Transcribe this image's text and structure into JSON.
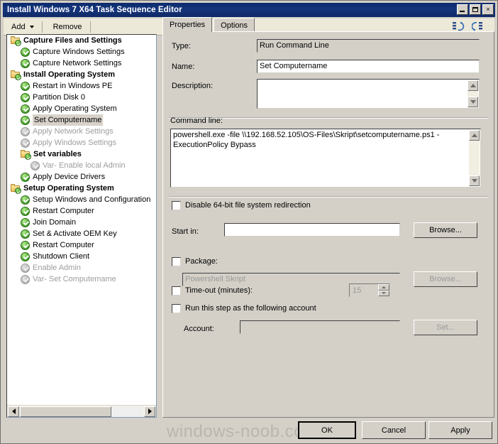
{
  "window": {
    "title": "Install Windows 7 X64 Task Sequence Editor",
    "minimize_label": "Minimize",
    "maximize_label": "Maximize",
    "close_label": "×"
  },
  "toolbar": {
    "add_label": "Add",
    "remove_label": "Remove",
    "move_up_icon": "move-up-icon",
    "move_down_icon": "move-down-icon"
  },
  "tree": {
    "items": [
      {
        "label": "Capture Files and Settings",
        "indent": 0,
        "icon": "folder",
        "style": "group"
      },
      {
        "label": "Capture Windows Settings",
        "indent": 1,
        "icon": "check",
        "style": "normal"
      },
      {
        "label": "Capture Network Settings",
        "indent": 1,
        "icon": "check",
        "style": "normal"
      },
      {
        "label": "Install Operating System",
        "indent": 0,
        "icon": "folder",
        "style": "group"
      },
      {
        "label": "Restart in Windows PE",
        "indent": 1,
        "icon": "check",
        "style": "normal"
      },
      {
        "label": "Partition Disk 0",
        "indent": 1,
        "icon": "check",
        "style": "normal"
      },
      {
        "label": "Apply Operating System",
        "indent": 1,
        "icon": "check",
        "style": "normal"
      },
      {
        "label": "Set Computername",
        "indent": 1,
        "icon": "check",
        "style": "selected"
      },
      {
        "label": "Apply Network Settings",
        "indent": 1,
        "icon": "check-gray",
        "style": "disabled"
      },
      {
        "label": "Apply Windows Settings",
        "indent": 1,
        "icon": "check-gray",
        "style": "disabled"
      },
      {
        "label": "Set variables",
        "indent": 1,
        "icon": "folder",
        "style": "group"
      },
      {
        "label": "Var- Enable local Admin",
        "indent": 2,
        "icon": "check-gray",
        "style": "disabled"
      },
      {
        "label": "Apply Device Drivers",
        "indent": 1,
        "icon": "check",
        "style": "normal"
      },
      {
        "label": "Setup Operating System",
        "indent": 0,
        "icon": "folder",
        "style": "group"
      },
      {
        "label": "Setup Windows and Configuration",
        "indent": 1,
        "icon": "check",
        "style": "normal"
      },
      {
        "label": "Restart Computer",
        "indent": 1,
        "icon": "check",
        "style": "normal"
      },
      {
        "label": "Join Domain",
        "indent": 1,
        "icon": "check",
        "style": "normal"
      },
      {
        "label": "Set & Activate OEM Key",
        "indent": 1,
        "icon": "check",
        "style": "normal"
      },
      {
        "label": "Restart Computer",
        "indent": 1,
        "icon": "check",
        "style": "normal"
      },
      {
        "label": "Shutdown Client",
        "indent": 1,
        "icon": "check",
        "style": "normal"
      },
      {
        "label": "Enable Admin",
        "indent": 1,
        "icon": "check-gray",
        "style": "disabled"
      },
      {
        "label": "Var- Set Computemame",
        "indent": 1,
        "icon": "check-gray",
        "style": "disabled"
      }
    ]
  },
  "tabs": [
    {
      "label": "Properties",
      "active": true
    },
    {
      "label": "Options",
      "active": false
    }
  ],
  "properties": {
    "type_label": "Type:",
    "type_value": "Run Command Line",
    "name_label": "Name:",
    "name_value": "Set Computername",
    "description_label": "Description:",
    "description_value": "",
    "command_line_label": "Command line:",
    "command_line_value": "powershell.exe -file \\\\192.168.52.105\\OS-Files\\Skript\\setcomputername.ps1 -ExecutionPolicy Bypass",
    "disable_redirection_label": "Disable 64-bit file system redirection",
    "disable_redirection_checked": false,
    "start_in_label": "Start in:",
    "start_in_value": "",
    "start_in_browse_label": "Browse...",
    "package_label": "Package:",
    "package_checked": false,
    "package_value": "Powershell Skript",
    "package_browse_label": "Browse...",
    "timeout_label": "Time-out (minutes):",
    "timeout_checked": false,
    "timeout_value": "15",
    "run_as_label": "Run this step as the following account",
    "run_as_checked": false,
    "account_label": "Account:",
    "account_value": "",
    "account_set_label": "Set..."
  },
  "footer": {
    "ok_label": "OK",
    "cancel_label": "Cancel",
    "apply_label": "Apply",
    "watermark": "windows-noob.com"
  }
}
